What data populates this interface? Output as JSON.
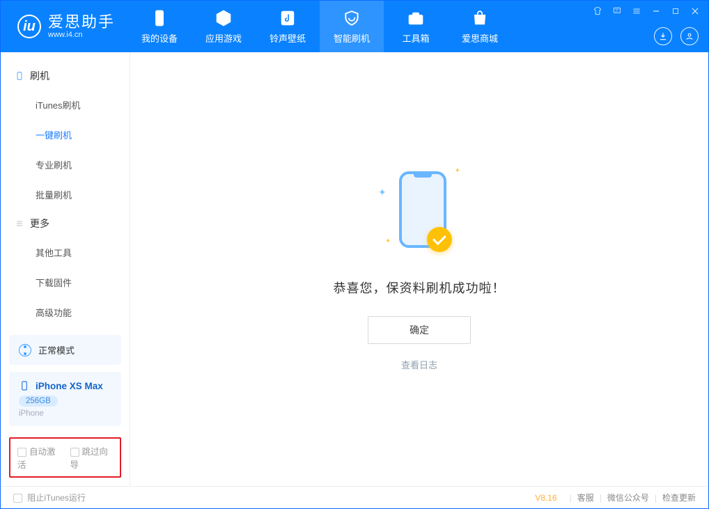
{
  "brand": {
    "title": "爱思助手",
    "subtitle": "www.i4.cn",
    "logo_letter": "iu"
  },
  "tabs": {
    "device": {
      "label": "我的设备"
    },
    "appgame": {
      "label": "应用游戏"
    },
    "ringwall": {
      "label": "铃声壁纸"
    },
    "flash": {
      "label": "智能刷机"
    },
    "toolbox": {
      "label": "工具箱"
    },
    "store": {
      "label": "爱思商城"
    }
  },
  "sidebar": {
    "cat_flash": "刷机",
    "items_flash": {
      "itunes": "iTunes刷机",
      "onekey": "一键刷机",
      "pro": "专业刷机",
      "batch": "批量刷机"
    },
    "cat_more": "更多",
    "items_more": {
      "other": "其他工具",
      "dlfw": "下载固件",
      "adv": "高级功能"
    }
  },
  "mode_box": {
    "label": "正常模式"
  },
  "device_box": {
    "name": "iPhone XS Max",
    "capacity": "256GB",
    "type": "iPhone"
  },
  "opts": {
    "auto_activate": "自动激活",
    "skip_guide": "跳过向导"
  },
  "main": {
    "success": "恭喜您，保资料刷机成功啦！",
    "ok": "确定",
    "view_log": "查看日志"
  },
  "footer": {
    "block_itunes": "阻止iTunes运行",
    "version": "V8.16",
    "support": "客服",
    "wechat": "微信公众号",
    "check_update": "检查更新"
  }
}
